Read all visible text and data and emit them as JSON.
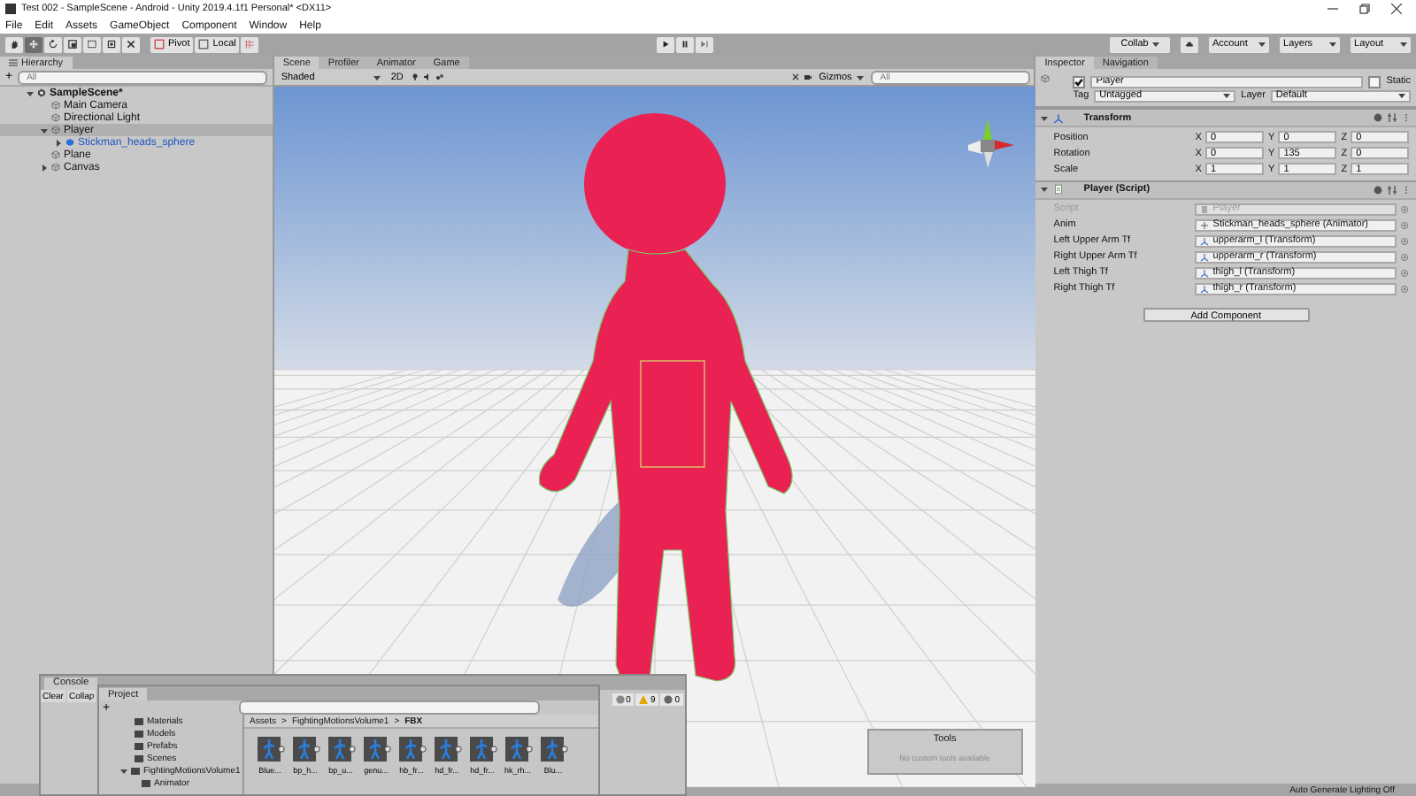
{
  "window": {
    "title": "Test 002 - SampleScene - Android - Unity 2019.4.1f1 Personal* <DX11>"
  },
  "menu": [
    "File",
    "Edit",
    "Assets",
    "GameObject",
    "Component",
    "Window",
    "Help"
  ],
  "toolbar": {
    "tools": [
      {
        "kind": "hand",
        "selected": false
      },
      {
        "kind": "move",
        "selected": true
      },
      {
        "kind": "rotate",
        "selected": false
      },
      {
        "kind": "scale",
        "selected": false
      },
      {
        "kind": "rect",
        "selected": false
      },
      {
        "kind": "transform",
        "selected": false
      },
      {
        "kind": "custom",
        "selected": false
      }
    ],
    "pivot": "Pivot",
    "local": "Local",
    "collab": "Collab",
    "account": "Account",
    "layers": "Layers",
    "layout": "Layout"
  },
  "hierarchy": {
    "tab": "Hierarchy",
    "add_label": "+",
    "search_placeholder": "All",
    "items": [
      {
        "label": "SampleScene*",
        "kind": "scene",
        "has_children": true,
        "expanded": true,
        "selected": false,
        "children": [
          {
            "label": "Main Camera",
            "kind": "object",
            "has_children": false,
            "expanded": false,
            "selected": false
          },
          {
            "label": "Directional Light",
            "kind": "object",
            "has_children": false,
            "expanded": false,
            "selected": false
          },
          {
            "label": "Player",
            "kind": "object",
            "has_children": true,
            "expanded": true,
            "selected": true,
            "children": [
              {
                "label": "Stickman_heads_sphere",
                "kind": "prefab",
                "has_children": true,
                "expanded": false,
                "selected": false
              }
            ]
          },
          {
            "label": "Plane",
            "kind": "object",
            "has_children": false,
            "expanded": false,
            "selected": false
          },
          {
            "label": "Canvas",
            "kind": "object",
            "has_children": true,
            "expanded": false,
            "selected": false
          }
        ]
      }
    ]
  },
  "scene": {
    "tabs": [
      {
        "label": "Scene",
        "selected": true
      },
      {
        "label": "Profiler",
        "selected": false
      },
      {
        "label": "Animator",
        "selected": false
      },
      {
        "label": "Game",
        "selected": false
      }
    ],
    "shading": "Shaded",
    "mode_2d": "2D",
    "gizmos": "Gizmos",
    "search_placeholder": "All",
    "tools_overlay": {
      "title": "Tools",
      "note": "No custom tools available"
    }
  },
  "inspector": {
    "tabs": [
      {
        "label": "Inspector",
        "selected": true
      },
      {
        "label": "Navigation",
        "selected": false
      }
    ],
    "object": {
      "active": true,
      "name": "Player",
      "static": false,
      "static_label": "Static",
      "tag_label": "Tag",
      "tag": "Untagged",
      "layer_label": "Layer",
      "layer": "Default"
    },
    "transform": {
      "title": "Transform",
      "expanded": true,
      "rows": [
        {
          "label": "Position",
          "fields": [
            {
              "axis": "X",
              "value": "0"
            },
            {
              "axis": "Y",
              "value": "0"
            },
            {
              "axis": "Z",
              "value": "0"
            }
          ]
        },
        {
          "label": "Rotation",
          "fields": [
            {
              "axis": "X",
              "value": "0"
            },
            {
              "axis": "Y",
              "value": "135"
            },
            {
              "axis": "Z",
              "value": "0"
            }
          ]
        },
        {
          "label": "Scale",
          "fields": [
            {
              "axis": "X",
              "value": "1"
            },
            {
              "axis": "Y",
              "value": "1"
            },
            {
              "axis": "Z",
              "value": "1"
            }
          ]
        }
      ]
    },
    "script": {
      "title": "Player (Script)",
      "expanded": true,
      "fields": [
        {
          "label": "Script",
          "value": "Player",
          "kind": "script",
          "disabled": true
        },
        {
          "label": "Anim",
          "value": "Stickman_heads_sphere (Animator)",
          "kind": "animator",
          "disabled": false
        },
        {
          "label": "Left Upper Arm Tf",
          "value": "upperarm_l (Transform)",
          "kind": "transform",
          "disabled": false
        },
        {
          "label": "Right Upper Arm Tf",
          "value": "upperarm_r (Transform)",
          "kind": "transform",
          "disabled": false
        },
        {
          "label": "Left Thigh Tf",
          "value": "thigh_l (Transform)",
          "kind": "transform",
          "disabled": false
        },
        {
          "label": "Right Thigh Tf",
          "value": "thigh_r (Transform)",
          "kind": "transform",
          "disabled": false
        }
      ]
    },
    "add_component": "Add Component"
  },
  "console": {
    "tab": "Console",
    "buttons": [
      "Clear",
      "Collap"
    ],
    "counts": [
      {
        "kind": "info",
        "value": "0"
      },
      {
        "kind": "warning",
        "value": "9"
      },
      {
        "kind": "error",
        "value": "0"
      }
    ]
  },
  "project": {
    "tab": "Project",
    "add_label": "+",
    "tree": [
      {
        "label": "Materials",
        "has_children": false
      },
      {
        "label": "Models",
        "has_children": false
      },
      {
        "label": "Prefabs",
        "has_children": false
      },
      {
        "label": "Scenes",
        "has_children": false
      },
      {
        "label": "FightingMotionsVolume1",
        "has_children": true,
        "expanded": true,
        "children": [
          {
            "label": "Animator",
            "has_children": false
          }
        ]
      }
    ],
    "breadcrumb": [
      {
        "label": "Assets"
      },
      {
        "label": "FightingMotionsVolume1"
      },
      {
        "label": "FBX"
      }
    ],
    "separator": ">",
    "assets": [
      "Blue...",
      "bp_h...",
      "bp_u...",
      "genu...",
      "hb_fr...",
      "hd_fr...",
      "hd_fr...",
      "hk_rh...",
      "Blu..."
    ]
  },
  "status_bar": "Auto Generate Lighting Off"
}
